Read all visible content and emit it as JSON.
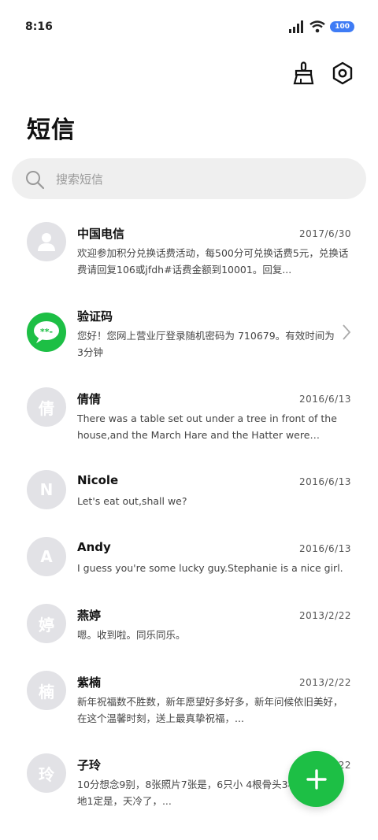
{
  "status_bar": {
    "time": "8:16",
    "battery": "100"
  },
  "header": {
    "title": "短信"
  },
  "search": {
    "placeholder": "搜索短信"
  },
  "threads": [
    {
      "name": "中国电信",
      "date": "2017/6/30",
      "preview": "欢迎参加积分兑换话费活动，每500分可兑换话费5元，兑换话费请回复106或jfdh#话费金额到10001。回复...",
      "avatar_text": ""
    },
    {
      "name": "验证码",
      "date": "",
      "preview": "您好！您网上营业厅登录随机密码为 710679。有效时间为3分钟",
      "avatar_text": "**-"
    },
    {
      "name": "倩倩",
      "date": "2016/6/13",
      "preview": "There was a table set out under a tree in front of the house,and the March Hare and the Hatter were having...",
      "avatar_text": "倩"
    },
    {
      "name": "Nicole",
      "date": "2016/6/13",
      "preview": "Let's eat out,shall we?",
      "avatar_text": "N"
    },
    {
      "name": "Andy",
      "date": "2016/6/13",
      "preview": "I guess you're some lucky guy.Stephanie is a nice girl.",
      "avatar_text": "A"
    },
    {
      "name": "燕婷",
      "date": "2013/2/22",
      "preview": "嗯。收到啦。同乐同乐。",
      "avatar_text": "婷"
    },
    {
      "name": "紫楠",
      "date": "2013/2/22",
      "preview": "新年祝福数不胜数，新年愿望好多好多，新年问候依旧美好，在这个温馨时刻，送上最真挚祝福，...",
      "avatar_text": "楠"
    },
    {
      "name": "子玲",
      "date": "2013/2/22",
      "preview": "10分想念9别，8张照片7张是，6只小 4根骨头3根归，2爪着地1定是，天冷了，...",
      "avatar_text": "玲"
    }
  ],
  "colors": {
    "accent": "#1dbf45",
    "avatar_bg": "#e2e2e6",
    "battery": "#3f7cf5"
  }
}
